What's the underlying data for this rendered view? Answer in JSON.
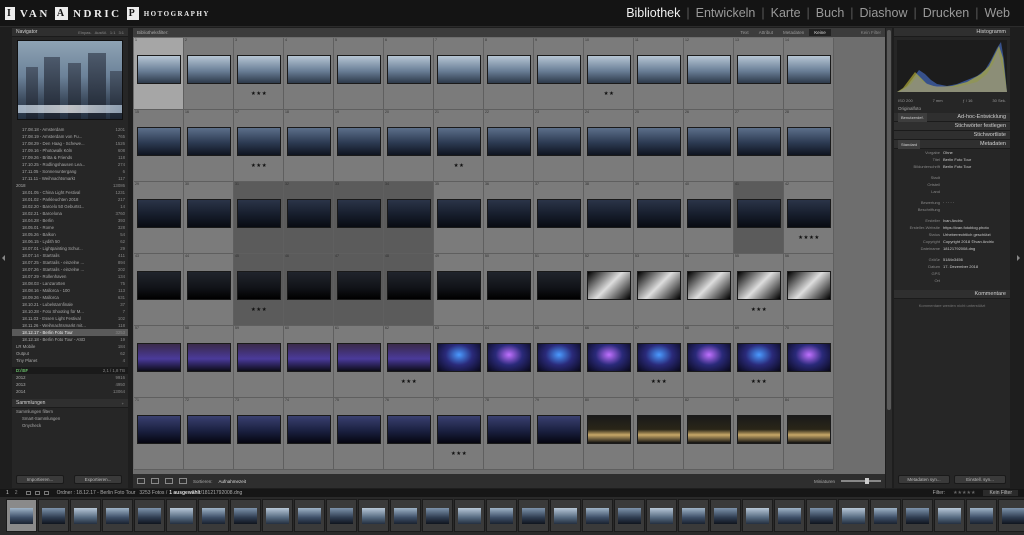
{
  "logo": {
    "box1": "I",
    "name": "VAN",
    "box2": "A",
    "name2": "NDRIC",
    "box3": "P",
    "tail": "HOTOGRAPHY"
  },
  "modules": [
    {
      "label": "Bibliothek",
      "active": true
    },
    {
      "label": "Entwickeln",
      "active": false
    },
    {
      "label": "Karte",
      "active": false
    },
    {
      "label": "Buch",
      "active": false
    },
    {
      "label": "Diashow",
      "active": false
    },
    {
      "label": "Drucken",
      "active": false
    },
    {
      "label": "Web",
      "active": false
    }
  ],
  "left": {
    "navigator": {
      "title": "Navigator",
      "options": [
        "Einpas.",
        "Ausfül.",
        "1:1",
        "3:1"
      ]
    },
    "folders": [
      {
        "name": "17.08.18 - Amsterdam",
        "count": "1201"
      },
      {
        "name": "17.08.19 - Amsterdam von Fu...",
        "count": "765"
      },
      {
        "name": "17.08.29 - Den Haag - Schewe...",
        "count": "1526"
      },
      {
        "name": "17.09.16 - Photowalk Köln",
        "count": "608"
      },
      {
        "name": "17.09.26 - Britta & Friends",
        "count": "118"
      },
      {
        "name": "17.10.25 - Rodlingshausen Lea...",
        "count": "274"
      },
      {
        "name": "17.11.05 - Sonnenuntergang",
        "count": "6"
      },
      {
        "name": "17.11.11 - Weihnachtsmarkt",
        "count": "117"
      },
      {
        "name": "2018",
        "count": "13086",
        "top": true
      },
      {
        "name": "18.01.05 - China Light Festival",
        "count": "1231"
      },
      {
        "name": "18.01.02 - Parkleuchten 2018",
        "count": "217"
      },
      {
        "name": "18.02.20 - Barcelo 50 Geburtst...",
        "count": "14"
      },
      {
        "name": "18.02.21 - Barcelona",
        "count": "3760"
      },
      {
        "name": "18.04.28 - Berlin",
        "count": "393"
      },
      {
        "name": "18.05.01 - Rome",
        "count": "328"
      },
      {
        "name": "18.05.26 - Balkon",
        "count": "54"
      },
      {
        "name": "18.06.15 - Lydith 50",
        "count": "62"
      },
      {
        "name": "18.07.01 - Lightpainting Schur...",
        "count": "29"
      },
      {
        "name": "18.07.14 - Startrails",
        "count": "411"
      },
      {
        "name": "18.07.25 - Startrails - einzelne ...",
        "count": "894"
      },
      {
        "name": "18.07.26 - Startrails - einzelne ...",
        "count": "202"
      },
      {
        "name": "18.07.29 - Rollenhaven",
        "count": "134"
      },
      {
        "name": "18.08.03 - Lanzarotten",
        "count": "75"
      },
      {
        "name": "18.08.16 - Mallorca - 100",
        "count": "113"
      },
      {
        "name": "18.09.26 - Mallorca",
        "count": "631"
      },
      {
        "name": "18.10.21 - Lubelstarnfinale",
        "count": "37"
      },
      {
        "name": "18.10.28 - Foto Shooting für M...",
        "count": "7"
      },
      {
        "name": "18.11.03 - Essen Light Festival",
        "count": "102"
      },
      {
        "name": "18.11.26 - Weihnachtsmarkt mit...",
        "count": "118"
      },
      {
        "name": "18.12.17 - Berlin Foto Tour",
        "count": "3253",
        "selected": true
      },
      {
        "name": "18.12.18 - Berlin Foto Tour - ASD",
        "count": "19"
      },
      {
        "name": "LR Mobile",
        "count": "184",
        "top": true
      },
      {
        "name": "Output",
        "count": "62",
        "top": true
      },
      {
        "name": "Tiny Planet",
        "count": "4",
        "top": true
      }
    ],
    "disk": {
      "label": "D:/ISF",
      "space": "2,1 / 1,8 TB"
    },
    "years": [
      {
        "name": "2012",
        "count": "9916"
      },
      {
        "name": "2013",
        "count": "4950"
      },
      {
        "name": "2014",
        "count": "13064"
      }
    ],
    "collections": {
      "title": "Sammlungen",
      "items": [
        "Sammlungen filtern",
        "Smart-Sammlungen",
        "Onycheck"
      ]
    },
    "import_button": "Importieren...",
    "export_button": "Exportieren..."
  },
  "center": {
    "filter": {
      "label": "Bibliotheksfilter:",
      "tabs": [
        "Text",
        "Attribut",
        "Metadaten",
        "Keine"
      ],
      "active_tab": "Keine",
      "preset": "Kein Filter"
    },
    "toolbar": {
      "sort_label": "Sortieren:",
      "sort_value": "Aufnahmezeit",
      "thumb_label": "Miniaturen"
    }
  },
  "right": {
    "histogram": {
      "title": "Histogramm",
      "iso": "ISO 200",
      "focal": "7 mm",
      "aperture": "ƒ / 16",
      "shutter": "30 Sek.",
      "original": "Originalfoto"
    },
    "quick_develop": {
      "preset": "Benutzerdef.",
      "title": "Ad-hoc-Entwicklung"
    },
    "keywording": {
      "title": "Stichwörter festlegen"
    },
    "keyword_list": {
      "title": "Stichwortliste"
    },
    "metadata": {
      "title": "Metadaten",
      "preset_label": "Standard",
      "preset": "Vorgabe",
      "preset_value": "Ohne"
    },
    "fields": [
      {
        "k": "Titel",
        "v": "Berlin Foto Tour"
      },
      {
        "k": "Bildunterschrift",
        "v": "Berlin Foto Tour"
      },
      {
        "k": "Stadt",
        "v": ""
      },
      {
        "k": "Ortsteil",
        "v": ""
      },
      {
        "k": "Land",
        "v": ""
      },
      {
        "k": "Bewertung",
        "v": "· · · · ·"
      },
      {
        "k": "Beschriftung",
        "v": ""
      },
      {
        "k": "Ersteller",
        "v": "Ivan Andric"
      },
      {
        "k": "Ersteller-Website",
        "v": "https://ivan.fotoblog.photo"
      },
      {
        "k": "Status",
        "v": "Urheberrechtlich geschützt"
      },
      {
        "k": "Copyright",
        "v": "Copyright 2018 ©Ivan Andric"
      },
      {
        "k": "Dateiname",
        "v": "18121792008.dng"
      },
      {
        "k": "Größe",
        "v": "5184x3456"
      },
      {
        "k": "Datum",
        "v": "17. Dezember 2018"
      },
      {
        "k": "GPS",
        "v": ""
      },
      {
        "k": "Ort",
        "v": ""
      }
    ],
    "comments": {
      "title": "Kommentare",
      "text": "Kommentare werden nicht unterstützt"
    },
    "sync_meta_button": "Metadaten syn...",
    "sync_settings_button": "Einstell. syn..."
  },
  "status": {
    "folder": "Ordner : 18.12.17 - Berlin Foto Tour",
    "photos": "3253 Fotos /",
    "selected": "1 ausgewählt",
    "file": "/18121792008.dng",
    "filter_label": "Filter:",
    "filter_value": "Kein Filter",
    "page": "1",
    "page2": "2"
  },
  "grid_rows": [
    {
      "stars": [
        "",
        "",
        "★★★",
        "",
        "",
        "",
        "",
        "",
        "",
        "★★",
        "",
        "",
        "",
        ""
      ]
    },
    {
      "stars": [
        "",
        "",
        "★★★",
        "",
        "",
        "",
        "★★",
        "",
        "",
        "",
        "",
        "",
        "",
        ""
      ]
    },
    {
      "stars": [
        "",
        "",
        "",
        "",
        "",
        "",
        "",
        "",
        "",
        "",
        "",
        "",
        "",
        "★★★★"
      ]
    },
    {
      "stars": [
        "",
        "",
        "★★★",
        "",
        "",
        "",
        "",
        "",
        "",
        "",
        "",
        "",
        "★★★",
        ""
      ]
    },
    {
      "stars": [
        "",
        "",
        "",
        "",
        "",
        "★★★",
        "",
        "",
        "",
        "",
        "★★★",
        "",
        "★★★",
        ""
      ]
    },
    {
      "stars": [
        "",
        "",
        "",
        "",
        "",
        "",
        "★★★",
        "",
        "",
        "",
        "",
        "",
        "",
        ""
      ]
    }
  ]
}
